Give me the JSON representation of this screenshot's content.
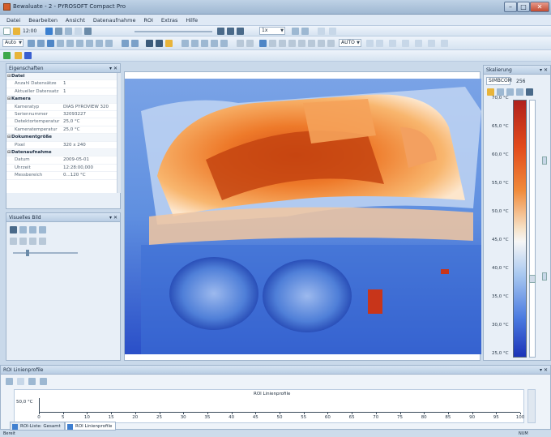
{
  "window": {
    "title": "Bewaluate - 2 - PYROSOFT Compact Pro",
    "controls": [
      "–",
      "□",
      "✕"
    ]
  },
  "menu": [
    "Datei",
    "Bearbeiten",
    "Ansicht",
    "Datenaufnahme",
    "ROI",
    "Extras",
    "Hilfe"
  ],
  "toolbar1": {
    "time_value": "12:00",
    "range_value": "1x"
  },
  "toolbar2": {
    "mode_value": "Auto",
    "preset_value": "AUTO"
  },
  "properties_panel": {
    "title": "Eigenschaften",
    "rows": [
      {
        "type": "cat",
        "label": "Datei"
      },
      {
        "type": "row",
        "label": "Anzahl Datensätze",
        "value": "1"
      },
      {
        "type": "row",
        "label": "Aktueller Datensatz",
        "value": "1"
      },
      {
        "type": "cat",
        "label": "Kamera"
      },
      {
        "type": "row",
        "label": "Kameratyp",
        "value": "DIAS PYROVIEW 320"
      },
      {
        "type": "row",
        "label": "Seriennummer",
        "value": "32093227"
      },
      {
        "type": "row",
        "label": "Detektortemperatur",
        "value": "25,0 °C"
      },
      {
        "type": "row",
        "label": "Kameratemperatur",
        "value": "25,0 °C"
      },
      {
        "type": "cat",
        "label": "Dokumentgröße"
      },
      {
        "type": "row",
        "label": "Pixel",
        "value": "320 x 240"
      },
      {
        "type": "cat",
        "label": "Datenaufnahme"
      },
      {
        "type": "row",
        "label": "Datum",
        "value": "2009-05-01"
      },
      {
        "type": "row",
        "label": "Uhrzeit",
        "value": "12:28:00,000"
      },
      {
        "type": "row",
        "label": "Messbereich",
        "value": "0...120 °C"
      }
    ]
  },
  "visual_panel": {
    "title": "Visuelles Bild"
  },
  "scale_panel": {
    "title": "Skalierung",
    "palette": "SIMBCOM",
    "palette_count": "256",
    "labels": [
      "70,0 °C",
      "65,0 °C",
      "60,0 °C",
      "55,0 °C",
      "50,0 °C",
      "45,0 °C",
      "40,0 °C",
      "35,0 °C",
      "30,0 °C",
      "25,0 °C"
    ]
  },
  "profile_panel": {
    "title": "ROI Linienprofile",
    "plot_title": "ROI Linienprofile",
    "y_label": "50,0 °C",
    "x_ticks": [
      "0",
      "5",
      "10",
      "15",
      "20",
      "25",
      "30",
      "35",
      "40",
      "45",
      "50",
      "55",
      "60",
      "65",
      "70",
      "75",
      "80",
      "85",
      "90",
      "95",
      "100"
    ]
  },
  "tabs": [
    "ROI-Liste: Gesamt",
    "ROI Linienprofile"
  ],
  "status": {
    "left": "Bereit",
    "right": "NUM"
  },
  "colors": {
    "scale_top": "#b0211c",
    "scale_mid": "#f6f6f6",
    "scale_bottom": "#1c34b8",
    "hot": "#e65a14",
    "cool": "#5f8fe0"
  }
}
